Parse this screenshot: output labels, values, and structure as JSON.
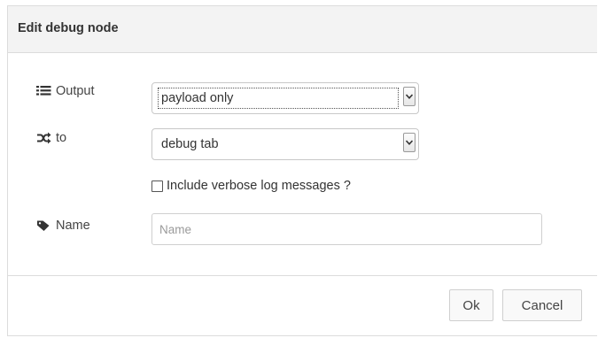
{
  "dialog": {
    "title": "Edit debug node"
  },
  "form": {
    "output": {
      "label": "Output",
      "icon": "list-icon",
      "selected": "payload only"
    },
    "to": {
      "label": "to",
      "icon": "shuffle-icon",
      "selected": "debug tab"
    },
    "verbose": {
      "label": "Include verbose log messages ?",
      "checked": false
    },
    "name": {
      "label": "Name",
      "icon": "tag-icon",
      "value": "",
      "placeholder": "Name"
    }
  },
  "footer": {
    "ok_label": "Ok",
    "cancel_label": "Cancel"
  }
}
